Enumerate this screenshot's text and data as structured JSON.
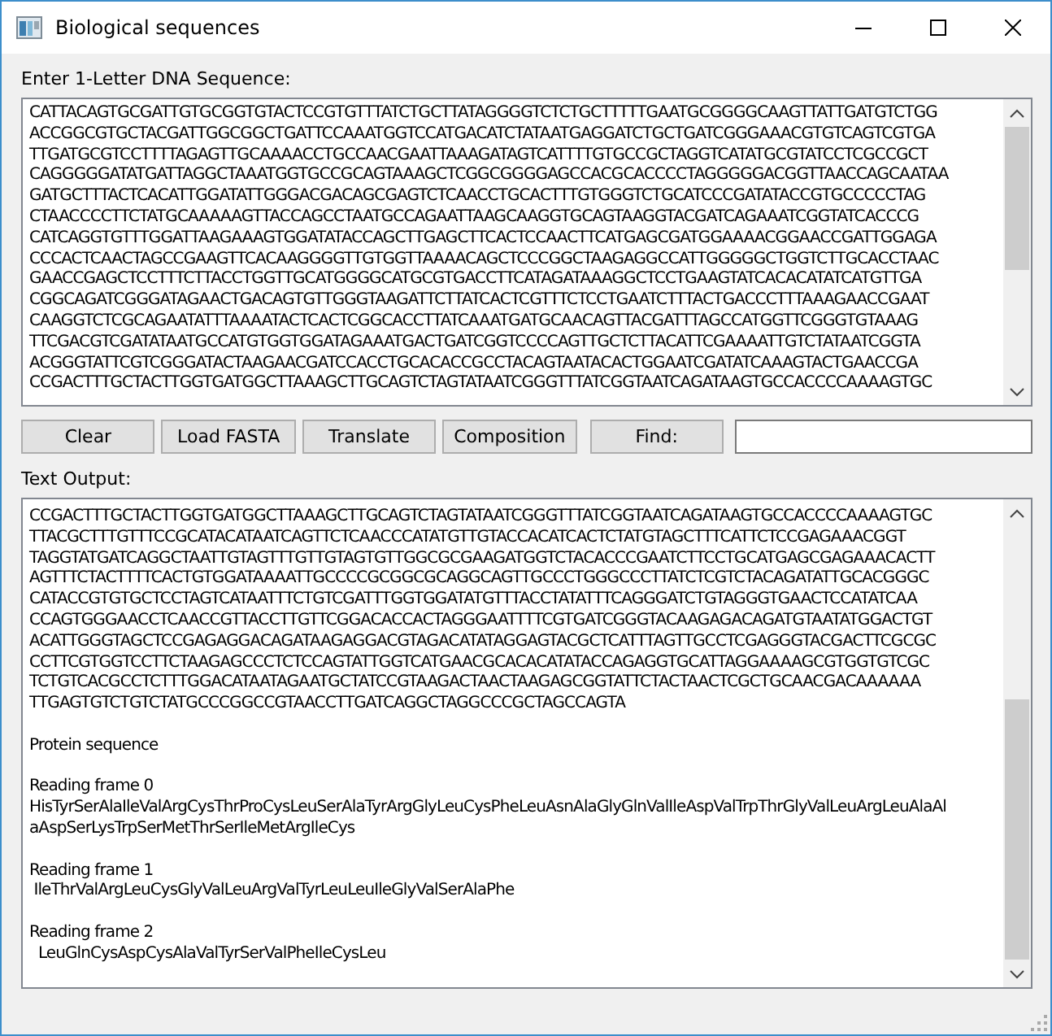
{
  "window": {
    "title": "Biological sequences"
  },
  "input_label": "Enter 1-Letter DNA Sequence:",
  "input_lines": [
    "CATTACAGTGCGATTGTGCGGTGTACTCCGTGTTTATCTGCTTATAGGGGTCTCTGCTTTTTGAATGCGGGGCAAGTTATTGATGTCTGG",
    "ACCGGCGTGCTACGATTGGCGGCTGATTCCAAATGGTCCATGACATCTATAATGAGGATCTGCTGATCGGGAAACGTGTCAGTCGTGA",
    "TTGATGCGTCCTTTTAGAGTTGCAAAACCTGCCAACGAATTAAAGATAGTCATTTTGTGCCGCTAGGTCATATGCGTATCCTCGCCGCT",
    "CAGGGGGATATGATTAGGCTAAATGGTGCCGCAGTAAAGCTCGGCGGGGAGCCACGCACCCCTAGGGGGACGGTTAACCAGCAATAA",
    "GATGCTTTACTCACATTGGATATTGGGACGACAGCGAGTCTCAACCTGCACTTTGTGGGTCTGCATCCCGATATACCGTGCCCCCTAG",
    "CTAACCCCTTCTATGCAAAAAGTTACCAGCCTAATGCCAGAATTAAGCAAGGTGCAGTAAGGTACGATCAGAAATCGGTATCACCCG",
    "CATCAGGTGTTTGGATTAAGAAAGTGGATATACCAGCTTGAGCTTCACTCCAACTTCATGAGCGATGGAAAACGGAACCGATTGGAGA",
    "CCCACTCAACTAGCCGAAGTTCACAAGGGGTTGTGGTTAAAACAGCTCCCGGCTAAGAGGCCATTGGGGGCTGGTCTTGCACCTAAC",
    "GAACCGAGCTCCTTTCTTACCTGGTTGCATGGGGCATGCGTGACCTTCATAGATAAAGGCTCCTGAAGTATCACACATATCATGTTGA",
    "CGGCAGATCGGGATAGAACTGACAGTGTTGGGTAAGATTCTTATCACTCGTTTCTCCTGAATCTTTACTGACCCTTTAAAGAACCGAAT",
    "CAAGGTCTCGCAGAATATTTAAAATACTCACTCGGCACCTTATCAAATGATGCAACAGTTACGATTTAGCCATGGTTCGGGTGTAAAG",
    "TTCGACGTCGATATAATGCCATGTGGTGGATAGAAATGACTGATCGGTCCCCAGTTGCTCTTACATTCGAAAATTGTCTATAATCGGTA",
    "ACGGGTATTCGTCGGGATACTAAGAACGATCCACCTGCACACCGCCTACAGTAATACACTGGAATCGATATCAAAGTACTGAACCGA",
    "CCGACTTTGCTACTTGGTGATGGCTTAAAGCTTGCAGTCTAGTATAATCGGGTTTATCGGTAATCAGATAAGTGCCACCCCAAAAGTGC"
  ],
  "buttons": [
    "Clear",
    "Load FASTA",
    "Translate",
    "Composition",
    "Find:"
  ],
  "output_label": "Text Output:",
  "output_dna_lines": [
    "CCGACTTTGCTACTTGGTGATGGCTTAAAGCTTGCAGTCTAGTATAATCGGGTTTATCGGTAATCAGATAAGTGCCACCCCAAAAGTGC",
    "TTACGCTTTGTTTCCGCATACATAATCAGTTCTCAACCCATATGTTGTACCACATCACTCTATGTAGCTTTCATTCTCCGAGAAACGGT",
    "TAGGTATGATCAGGCTAATTGTAGTTTGTTGTAGTGTTGGCGCGAAGATGGTCTACACCCGAATCTTCCTGCATGAGCGAGAAACACTT",
    "AGTTTCTACTTTTCACTGTGGATAAAATTGCCCCGCGGCGCAGGCAGTTGCCCTGGGCCCTTATCTCGTCTACAGATATTGCACGGGC",
    "CATACCGTGTGCTCCTAGTCATAATTTCTGTCGATTTGGTGGATATGTTTACCTATATTTCAGGGATCTGTAGGGTGAACTCCATATCAA",
    "CCAGTGGGAACCTCAACCGTTACCTTGTTCGGACACCACTAGGGAATTTTCGTGATCGGGTACAAGAGACAGATGTAATATGGACTGT",
    "ACATTGGGTAGCTCCGAGAGGACAGATAAGAGGACGTAGACATATAGGAGTACGCTCATTTAGTTGCCTCGAGGGTACGACTTCGCGC",
    "CCTTCGTGGTCCTTCTAAGAGCCCTCTCCAGTATTGGTCATGAACGCACACATATACCAGAGGTGCATTAGGAAAAGCGTGGTGTCGC",
    "TCTGTCACGCCTCTTTGGACATAATAGAATGCTATCCGTAAGACTAACTAAGAGCGGTATTCTACTAACTCGCTGCAACGACAAAAAA",
    "TTGAGTGTCTGTCTATGCCCGGCCGTAACCTTGATCAGGCTAGGCCCGCTAGCCAGTA"
  ],
  "protein_heading": "Protein sequence",
  "frames": [
    {
      "label": "Reading frame 0",
      "lines": [
        "HisTyrSerAlaIleValArgCysThrProCysLeuSerAlaTyrArgGlyLeuCysPheLeuAsnAlaGlyGlnValIleAspValTrpThrGlyValLeuArgLeuAlaAl",
        "aAspSerLysTrpSerMetThrSerIleMetArgIleCys"
      ]
    },
    {
      "label": "Reading frame 1",
      "lines": [
        " IleThrValArgLeuCysGlyValLeuArgValTyrLeuLeuIleGlyValSerAlaPhe"
      ]
    },
    {
      "label": "Reading frame 2",
      "lines": [
        "  LeuGlnCysAspCysAlaValTyrSerValPheIleCysLeu"
      ]
    }
  ]
}
